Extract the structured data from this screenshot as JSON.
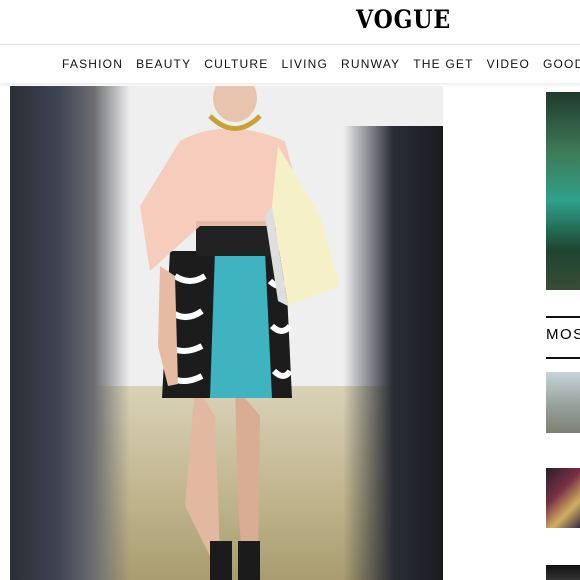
{
  "header": {
    "logo": "VOGUE"
  },
  "nav": {
    "items": [
      "FASHION",
      "BEAUTY",
      "CULTURE",
      "LIVING",
      "RUNWAY",
      "THE GET",
      "VIDEO",
      "GOOD MORNING VOGUE"
    ]
  },
  "sidebar": {
    "heading_partial": "MOS"
  },
  "colors": {
    "background": "#ffffff",
    "text": "#000000",
    "divider": "#e2e2e2"
  }
}
